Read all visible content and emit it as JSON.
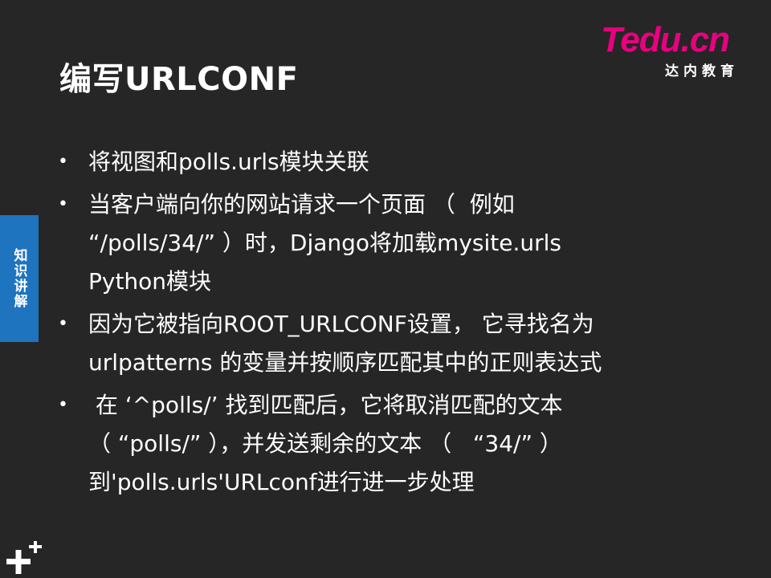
{
  "slide": {
    "title": "编写URLCONF",
    "side_tab": "知识讲解"
  },
  "logo": {
    "mark_t": "T",
    "mark_rest": "edu.cn",
    "subtitle": "达内教育"
  },
  "bullets": [
    {
      "lines": [
        "将视图和polls.urls模块关联"
      ]
    },
    {
      "lines": [
        "当客户端向你的网站请求一个页面 （  例如",
        "“/polls/34/” ）时，Django将加载mysite.urls",
        "Python模块"
      ]
    },
    {
      "lines": [
        "因为它被指向ROOT_URLCONF设置， 它寻找名为",
        "urlpatterns 的变量并按顺序匹配其中的正则表达式"
      ]
    },
    {
      "lines": [
        " 在 ‘^polls/’ 找到匹配后，它将取消匹配的文本",
        "（ “polls/” ），并发送剩余的文本 （   “34/” ）",
        "到'polls.urls'URLconf进行进一步处理"
      ]
    }
  ],
  "colors": {
    "background": "#262626",
    "side_tab": "#1f74c0",
    "logo_accent": "#e8007f"
  },
  "icons": {
    "corner": "plus-icon"
  }
}
